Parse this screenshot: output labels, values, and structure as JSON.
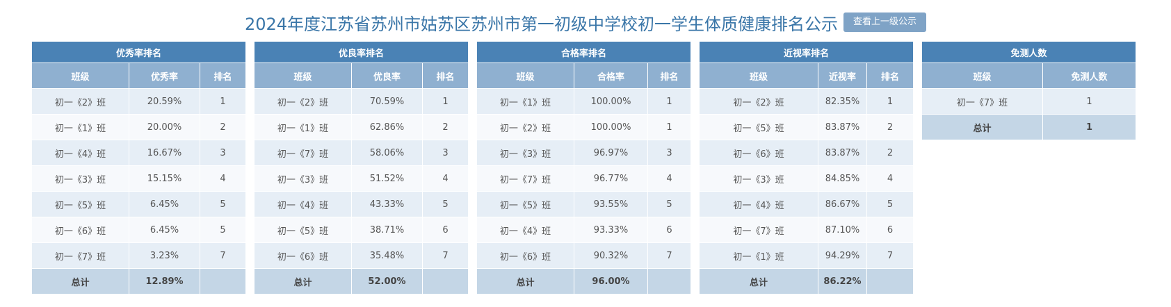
{
  "title": "2024年度江苏省苏州市姑苏区苏州市第一初级中学校初一学生体质健康排名公示",
  "prev_button": "查看上一级公示",
  "tables": [
    {
      "caption": "优秀率排名",
      "headers": [
        "班级",
        "优秀率",
        "排名"
      ],
      "rows": [
        [
          "初一《2》班",
          "20.59%",
          "1"
        ],
        [
          "初一《1》班",
          "20.00%",
          "2"
        ],
        [
          "初一《4》班",
          "16.67%",
          "3"
        ],
        [
          "初一《3》班",
          "15.15%",
          "4"
        ],
        [
          "初一《5》班",
          "6.45%",
          "5"
        ],
        [
          "初一《6》班",
          "6.45%",
          "5"
        ],
        [
          "初一《7》班",
          "3.23%",
          "7"
        ]
      ],
      "total": [
        "总计",
        "12.89%",
        ""
      ]
    },
    {
      "caption": "优良率排名",
      "headers": [
        "班级",
        "优良率",
        "排名"
      ],
      "rows": [
        [
          "初一《2》班",
          "70.59%",
          "1"
        ],
        [
          "初一《1》班",
          "62.86%",
          "2"
        ],
        [
          "初一《7》班",
          "58.06%",
          "3"
        ],
        [
          "初一《3》班",
          "51.52%",
          "4"
        ],
        [
          "初一《4》班",
          "43.33%",
          "5"
        ],
        [
          "初一《5》班",
          "38.71%",
          "6"
        ],
        [
          "初一《6》班",
          "35.48%",
          "7"
        ]
      ],
      "total": [
        "总计",
        "52.00%",
        ""
      ]
    },
    {
      "caption": "合格率排名",
      "headers": [
        "班级",
        "合格率",
        "排名"
      ],
      "rows": [
        [
          "初一《1》班",
          "100.00%",
          "1"
        ],
        [
          "初一《2》班",
          "100.00%",
          "1"
        ],
        [
          "初一《3》班",
          "96.97%",
          "3"
        ],
        [
          "初一《7》班",
          "96.77%",
          "4"
        ],
        [
          "初一《5》班",
          "93.55%",
          "5"
        ],
        [
          "初一《4》班",
          "93.33%",
          "6"
        ],
        [
          "初一《6》班",
          "90.32%",
          "7"
        ]
      ],
      "total": [
        "总计",
        "96.00%",
        ""
      ]
    },
    {
      "caption": "近视率排名",
      "headers": [
        "班级",
        "近视率",
        "排名"
      ],
      "rows": [
        [
          "初一《2》班",
          "82.35%",
          "1"
        ],
        [
          "初一《5》班",
          "83.87%",
          "2"
        ],
        [
          "初一《6》班",
          "83.87%",
          "2"
        ],
        [
          "初一《3》班",
          "84.85%",
          "4"
        ],
        [
          "初一《4》班",
          "86.67%",
          "5"
        ],
        [
          "初一《7》班",
          "87.10%",
          "6"
        ],
        [
          "初一《1》班",
          "94.29%",
          "7"
        ]
      ],
      "total": [
        "总计",
        "86.22%",
        ""
      ]
    },
    {
      "caption": "免测人数",
      "headers": [
        "班级",
        "免测人数"
      ],
      "rows": [
        [
          "初一《7》班",
          "1"
        ]
      ],
      "total": [
        "总计",
        "1"
      ]
    }
  ]
}
